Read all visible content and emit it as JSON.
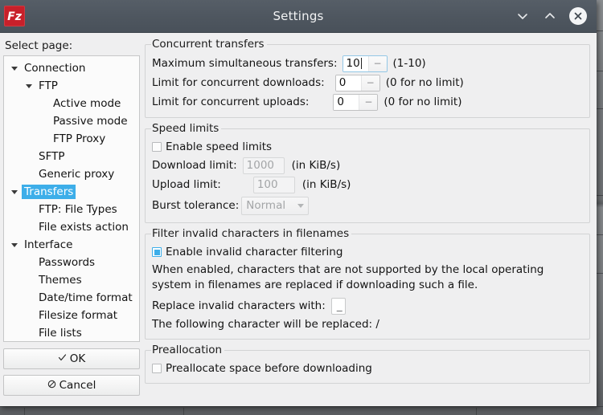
{
  "window": {
    "title": "Settings",
    "logo_icon": "filezilla-logo-icon",
    "minimize_icon": "chevron-down-icon",
    "maximize_icon": "chevron-up-icon",
    "close_icon": "close-circle-icon"
  },
  "sidebar": {
    "label": "Select page:",
    "items": [
      {
        "label": "Connection",
        "level": 0,
        "expander": true,
        "selected": false
      },
      {
        "label": "FTP",
        "level": 1,
        "expander": true,
        "selected": false
      },
      {
        "label": "Active mode",
        "level": 2,
        "expander": false,
        "selected": false
      },
      {
        "label": "Passive mode",
        "level": 2,
        "expander": false,
        "selected": false
      },
      {
        "label": "FTP Proxy",
        "level": 2,
        "expander": false,
        "selected": false
      },
      {
        "label": "SFTP",
        "level": 1,
        "expander": false,
        "selected": false
      },
      {
        "label": "Generic proxy",
        "level": 1,
        "expander": false,
        "selected": false
      },
      {
        "label": "Transfers",
        "level": 0,
        "expander": true,
        "selected": true
      },
      {
        "label": "FTP: File Types",
        "level": 1,
        "expander": false,
        "selected": false
      },
      {
        "label": "File exists action",
        "level": 1,
        "expander": false,
        "selected": false
      },
      {
        "label": "Interface",
        "level": 0,
        "expander": true,
        "selected": false
      },
      {
        "label": "Passwords",
        "level": 1,
        "expander": false,
        "selected": false
      },
      {
        "label": "Themes",
        "level": 1,
        "expander": false,
        "selected": false
      },
      {
        "label": "Date/time format",
        "level": 1,
        "expander": false,
        "selected": false
      },
      {
        "label": "Filesize format",
        "level": 1,
        "expander": false,
        "selected": false
      },
      {
        "label": "File lists",
        "level": 1,
        "expander": false,
        "selected": false
      }
    ],
    "ok_label": "OK",
    "ok_icon": "check-icon",
    "cancel_label": "Cancel",
    "cancel_icon": "prohibited-icon"
  },
  "concurrent": {
    "legend": "Concurrent transfers",
    "max_label": "Maximum simultaneous transfers:",
    "max_value": "10",
    "max_hint": "(1-10)",
    "downloads_label": "Limit for concurrent downloads:",
    "downloads_value": "0",
    "downloads_hint": "(0 for no limit)",
    "uploads_label": "Limit for concurrent uploads:",
    "uploads_value": "0",
    "uploads_hint": "(0 for no limit)",
    "spin_down_glyph": "−"
  },
  "speed": {
    "legend": "Speed limits",
    "enable_label": "Enable speed limits",
    "enable_checked": false,
    "download_label": "Download limit:",
    "download_value": "1000",
    "download_unit": "(in KiB/s)",
    "upload_label": "Upload limit:",
    "upload_value": "100",
    "upload_unit": "(in KiB/s)",
    "burst_label": "Burst tolerance:",
    "burst_value": "Normal"
  },
  "filter": {
    "legend": "Filter invalid characters in filenames",
    "enable_label": "Enable invalid character filtering",
    "enable_checked": true,
    "description": "When enabled, characters that are not supported by the local operating system in filenames are replaced if downloading such a file.",
    "replace_label": "Replace invalid characters with:",
    "replace_value": "_",
    "replaced_note": "The following character will be replaced: /"
  },
  "preallocation": {
    "legend": "Preallocation",
    "enable_label": "Preallocate space before downloading",
    "enable_checked": false
  },
  "colors": {
    "accent": "#3daee9",
    "titlebar": "#4e565f",
    "logo_red": "#c8202a"
  }
}
